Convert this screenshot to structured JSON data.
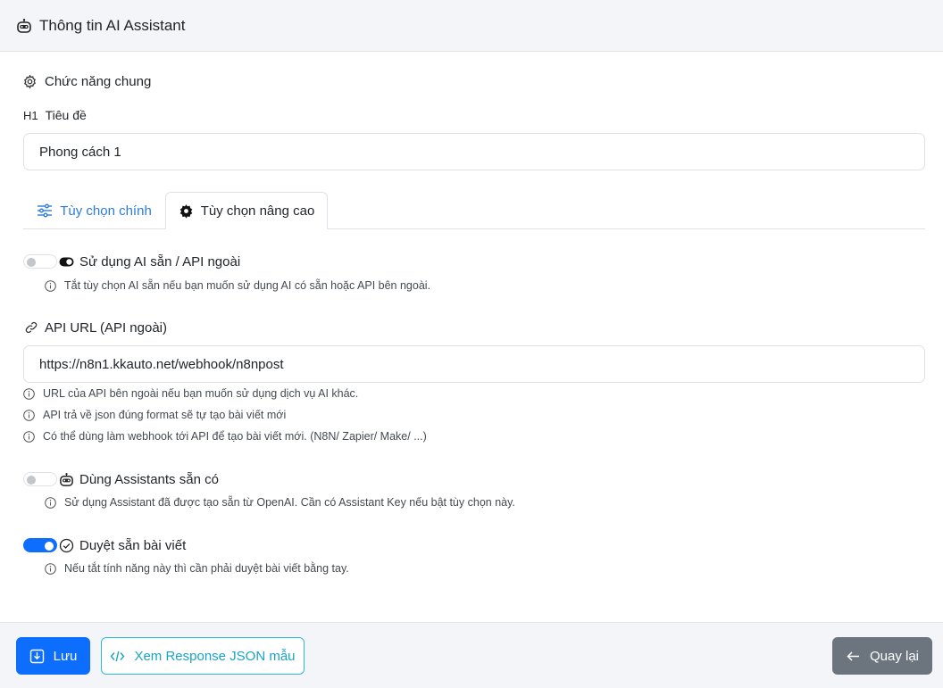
{
  "header": {
    "title": "Thông tin AI Assistant",
    "icon": "robot-icon"
  },
  "section": {
    "title": "Chức năng chung",
    "icon": "gear-outline-icon"
  },
  "title_field": {
    "tag": "H1",
    "label": "Tiêu đề",
    "value": "Phong cách 1"
  },
  "tabs": [
    {
      "label": "Tùy chọn chính",
      "icon": "sliders-icon",
      "active": false
    },
    {
      "label": "Tùy chọn nâng cao",
      "icon": "gear-filled-icon",
      "active": true
    }
  ],
  "options": {
    "use_ai": {
      "label": "Sử dụng AI sẵn / API ngoài",
      "enabled": false,
      "help": "Tắt tùy chọn AI sẵn nếu bạn muốn sử dụng AI có sẵn hoặc API bên ngoài."
    },
    "api_url": {
      "label": "API URL (API ngoài)",
      "value": "https://n8n1.kkauto.net/webhook/n8npost",
      "help": [
        "URL của API bên ngoài nếu bạn muốn sử dụng dịch vụ AI khác.",
        "API trả về json đúng format sẽ tự tạo bài viết mới",
        "Có thể dùng làm webhook tới API để tạo bài viết mới. (N8N/ Zapier/ Make/ ...)"
      ]
    },
    "assistants": {
      "label": "Dùng Assistants sẵn có",
      "enabled": false,
      "help": "Sử dụng Assistant đã được tạo sẵn từ OpenAI. Cần có Assistant Key nếu bật tùy chọn này."
    },
    "auto_approve": {
      "label": "Duyệt sẵn bài viết",
      "enabled": true,
      "help": "Nếu tắt tính năng này thì cần phải duyệt bài viết bằng tay."
    }
  },
  "footer": {
    "save_label": "Lưu",
    "json_label": "Xem Response JSON mẫu",
    "back_label": "Quay lại"
  },
  "colors": {
    "primary": "#0d6efd",
    "info": "#2bbbd8",
    "secondary": "#6c757d",
    "tab_link": "#2b7bdc"
  }
}
